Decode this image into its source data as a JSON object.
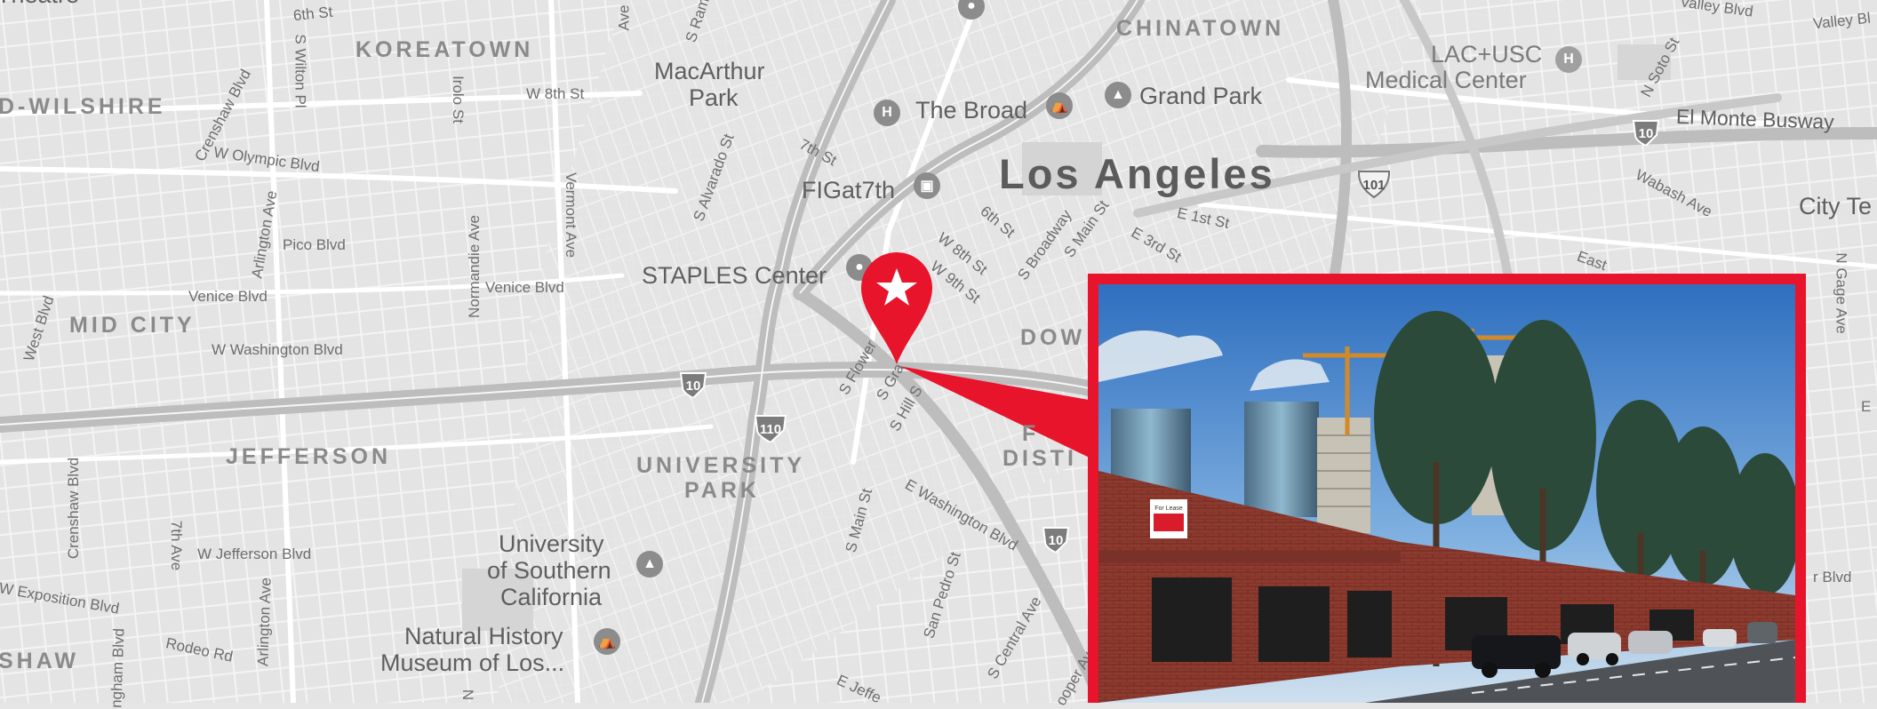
{
  "map": {
    "city_label": "Los Angeles",
    "neighborhoods": [
      {
        "id": "koreatown",
        "text": "KOREATOWN"
      },
      {
        "id": "chinatown",
        "text": "CHINATOWN"
      },
      {
        "id": "wilshire",
        "text": "D-WILSHIRE"
      },
      {
        "id": "midcity",
        "text": "MID CITY"
      },
      {
        "id": "jefferson",
        "text": "JEFFERSON"
      },
      {
        "id": "university-park-1",
        "text": "UNIVERSITY"
      },
      {
        "id": "university-park-2",
        "text": "PARK"
      },
      {
        "id": "downtown",
        "text": "DOW"
      },
      {
        "id": "district-1",
        "text": "F"
      },
      {
        "id": "district-2",
        "text": "DISTI"
      },
      {
        "id": "shaw",
        "text": "SHAW"
      }
    ],
    "pois": [
      {
        "id": "macarthur-1",
        "text": "MacArthur"
      },
      {
        "id": "macarthur-2",
        "text": "Park"
      },
      {
        "id": "the-broad",
        "text": "The Broad"
      },
      {
        "id": "grand-park",
        "text": "Grand Park"
      },
      {
        "id": "lac-usc-1",
        "text": "LAC+USC"
      },
      {
        "id": "lac-usc-2",
        "text": "Medical Center"
      },
      {
        "id": "figat7th",
        "text": "FIGat7th"
      },
      {
        "id": "staples",
        "text": "STAPLES Center"
      },
      {
        "id": "usc-1",
        "text": "University"
      },
      {
        "id": "usc-2",
        "text": "of Southern"
      },
      {
        "id": "usc-3",
        "text": "California"
      },
      {
        "id": "nhm-1",
        "text": "Natural History"
      },
      {
        "id": "nhm-2",
        "text": "Museum of Los..."
      },
      {
        "id": "el-monte",
        "text": "El Monte Busway"
      },
      {
        "id": "city-te",
        "text": "City Te"
      },
      {
        "id": "theatre",
        "text": "Theatre"
      }
    ],
    "streets": [
      {
        "id": "6th-st",
        "text": "6th St"
      },
      {
        "id": "s-wilton-pl",
        "text": "S Wilton Pl"
      },
      {
        "id": "crenshaw-blvd",
        "text": "Crenshaw Blvd"
      },
      {
        "id": "irolo-st",
        "text": "Irolo St"
      },
      {
        "id": "w-8th-st",
        "text": "W 8th St"
      },
      {
        "id": "w-olympic-blvd",
        "text": "W Olympic Blvd"
      },
      {
        "id": "arlington-ave",
        "text": "Arlington Ave"
      },
      {
        "id": "pico-blvd",
        "text": "Pico Blvd"
      },
      {
        "id": "vermont-ave",
        "text": "Vermont Ave"
      },
      {
        "id": "normandie-ave",
        "text": "Normandie Ave"
      },
      {
        "id": "venice-blvd-1",
        "text": "Venice Blvd"
      },
      {
        "id": "venice-blvd-2",
        "text": "Venice Blvd"
      },
      {
        "id": "west-blvd",
        "text": "West Blvd"
      },
      {
        "id": "w-washington-blvd",
        "text": "W Washington Blvd"
      },
      {
        "id": "s-alvarado-st",
        "text": "S Alvarado St"
      },
      {
        "id": "7th-st",
        "text": "7th St"
      },
      {
        "id": "6th-st-2",
        "text": "6th St"
      },
      {
        "id": "s-broadway",
        "text": "S Broadway"
      },
      {
        "id": "s-main-st",
        "text": "S Main St"
      },
      {
        "id": "e-1st-st",
        "text": "E 1st St"
      },
      {
        "id": "e-3rd-st",
        "text": "E 3rd St"
      },
      {
        "id": "w-8th-st-2",
        "text": "W 8th St"
      },
      {
        "id": "w-9th-st",
        "text": "W 9th St"
      },
      {
        "id": "s-flower",
        "text": "S Flower"
      },
      {
        "id": "s-grand",
        "text": "S Gra"
      },
      {
        "id": "s-hill",
        "text": "S Hill S"
      },
      {
        "id": "wabash-ave",
        "text": "Wabash Ave"
      },
      {
        "id": "n-soto-st",
        "text": "N Soto St"
      },
      {
        "id": "valley-blvd-1",
        "text": "Valley Blvd"
      },
      {
        "id": "valley-blvd-2",
        "text": "Valley Bl"
      },
      {
        "id": "east",
        "text": "East"
      },
      {
        "id": "n-gage-ave",
        "text": "N Gage Ave"
      },
      {
        "id": "crenshaw-blvd-2",
        "text": "Crenshaw Blvd"
      },
      {
        "id": "7th-ave",
        "text": "7th Ave"
      },
      {
        "id": "w-jefferson-blvd",
        "text": "W Jefferson Blvd"
      },
      {
        "id": "arlington-ave-2",
        "text": "Arlington Ave"
      },
      {
        "id": "w-exposition-blvd",
        "text": "W Exposition Blvd"
      },
      {
        "id": "rodeo-rd",
        "text": "Rodeo Rd"
      },
      {
        "id": "s-main-st-2",
        "text": "S Main St"
      },
      {
        "id": "e-washington-blvd",
        "text": "E Washington Blvd"
      },
      {
        "id": "san-pedro-st",
        "text": "San Pedro St"
      },
      {
        "id": "s-central-ave",
        "text": "S Central Ave"
      },
      {
        "id": "hooper-av",
        "text": "ooper Av"
      },
      {
        "id": "e-jeff",
        "text": "E Jeffe"
      },
      {
        "id": "r-blvd",
        "text": "r Blvd"
      },
      {
        "id": "s-ramp",
        "text": "S Ramp"
      },
      {
        "id": "ave-top",
        "text": "Ave"
      },
      {
        "id": "e-right",
        "text": "E"
      },
      {
        "id": "buckingham",
        "text": "ngham Blvd"
      },
      {
        "id": "n-bottom",
        "text": "N"
      }
    ],
    "shields": [
      {
        "id": "i10-left",
        "text": "10",
        "type": "interstate"
      },
      {
        "id": "i110",
        "text": "110",
        "type": "interstate"
      },
      {
        "id": "i10-right",
        "text": "10",
        "type": "interstate"
      },
      {
        "id": "us101",
        "text": "101",
        "type": "us"
      },
      {
        "id": "i10-east",
        "text": "10",
        "type": "interstate"
      }
    ],
    "marker": {
      "icon": "star-icon",
      "color": "#e8142c"
    },
    "photo": {
      "frame_color": "#e8142c",
      "sign_text": "For Lease"
    }
  }
}
